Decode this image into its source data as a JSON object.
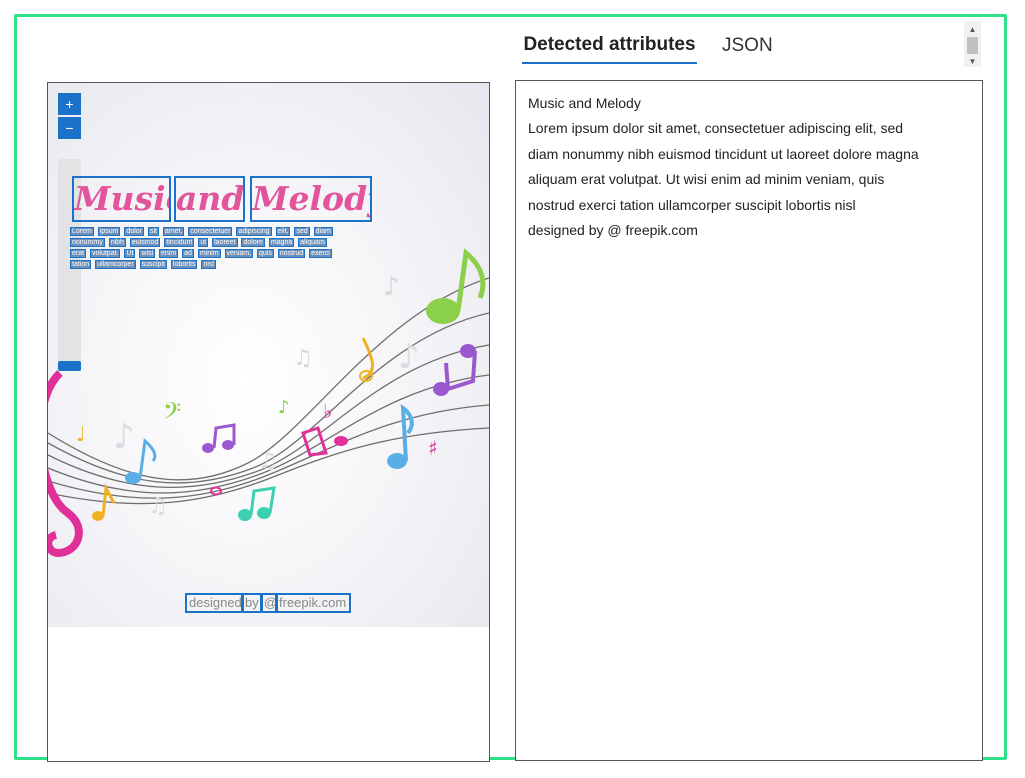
{
  "tabs": [
    {
      "label": "Detected attributes",
      "active": true
    },
    {
      "label": "JSON",
      "active": false
    }
  ],
  "zoom": {
    "in_label": "+",
    "out_label": "−"
  },
  "poster": {
    "title_words": [
      "Music",
      "and",
      "Melody"
    ],
    "lorem": "Lorem ipsum dolor sit amet, consectetuer adipiscing elit, sed diam nonummy nibh euismod tincidunt ut laoreet dolore magna aliquam erat volutpat. Ut wisi enim ad minim veniam, quis nostrud exerci tation ullamcorper suscipit lobortis nisl",
    "credit_words": [
      "designed",
      "by",
      "@",
      "freepik.com"
    ]
  },
  "detected_text": [
    "Music and Melody",
    "Lorem ipsum dolor sit amet, consectetuer adipiscing elit, sed",
    "diam nonummy nibh euismod tincidunt ut laoreet dolore magna",
    "aliquam erat volutpat. Ut wisi enim ad minim veniam, quis",
    "nostrud exerci tation ullamcorper suscipit lobortis nisl",
    "designed by @ freepik.com"
  ],
  "colors": {
    "accent": "#1a73c8",
    "frame": "#2fe08a",
    "title_pink": "#e2559d"
  }
}
